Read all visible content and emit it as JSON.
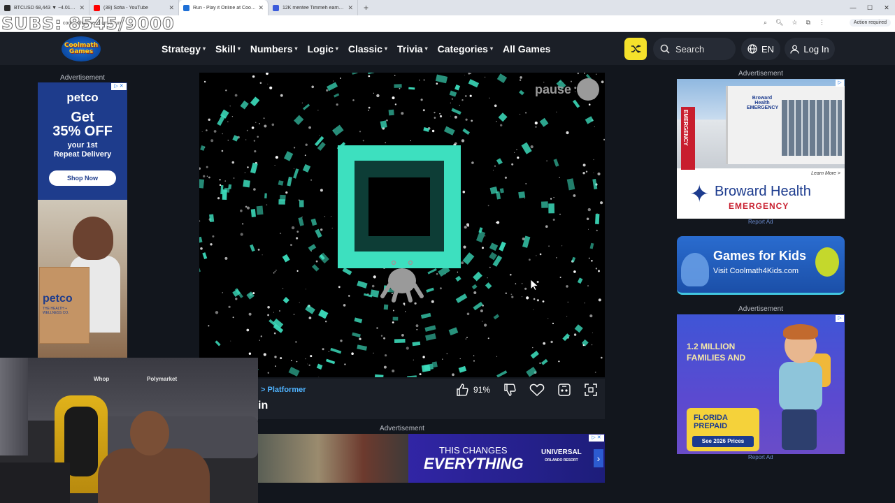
{
  "browser": {
    "tabs": [
      {
        "label": "BTCUSD 68,443 ▼ −4.01% Mi...",
        "favicon_color": "#2b2b2b",
        "active": false
      },
      {
        "label": "(38) Sofia - YouTube",
        "favicon_color": "#ff0000",
        "active": false
      },
      {
        "label": "Run - Play it Online at Coolmath...",
        "favicon_color": "#1f70d6",
        "active": true
      },
      {
        "label": "12K mentee Timmeh earns prop...",
        "favicon_color": "#3b5bdb",
        "active": false
      }
    ],
    "url": "coolmathgames.com/0-run",
    "action_required": "Action required",
    "overlay_text": "SUBS: 8545/9000"
  },
  "site": {
    "logo_line1": "Coolmath",
    "logo_line2": "Games",
    "menu": [
      {
        "label": "Strategy",
        "dropdown": true
      },
      {
        "label": "Skill",
        "dropdown": true
      },
      {
        "label": "Numbers",
        "dropdown": true
      },
      {
        "label": "Logic",
        "dropdown": true
      },
      {
        "label": "Classic",
        "dropdown": true
      },
      {
        "label": "Trivia",
        "dropdown": true
      },
      {
        "label": "Categories",
        "dropdown": true
      },
      {
        "label": "All Games",
        "dropdown": false
      }
    ],
    "search_label": "Search",
    "lang_label": "EN",
    "login_label": "Log In",
    "accent_color": "#f5e12b"
  },
  "ad_label": "Advertisement",
  "report_ad": "Report Ad",
  "left_ad": {
    "brand": "petco",
    "offer_line1": "Get",
    "offer_line2": "35% OFF",
    "sub_line1": "your 1st",
    "sub_line2": "Repeat Delivery",
    "cta": "Shop Now",
    "box_brand": "petco",
    "box_tag": "THE HEALTH + WELLNESS CO."
  },
  "game": {
    "pause_label": "pause",
    "breadcrumb": "> Platformer",
    "title_fragment": "in",
    "rating": "91%",
    "tunnel_color": "#3de0bf"
  },
  "bottom_ad": {
    "tagline_small": "THIS CHANGES",
    "tagline_big": "EVERYTHING",
    "logo_line1": "UNIVERSAL",
    "logo_line2": "ORLANDO RESORT"
  },
  "right_ad_1": {
    "building_sign": "Broward Health EMERGENCY",
    "learn_more": "Learn More >",
    "name": "Broward Health",
    "emergency": "EMERGENCY",
    "side_sign": "EMERGENCY"
  },
  "right_ad_2": {
    "title": "Games for Kids",
    "subtitle": "Visit Coolmath4Kids.com"
  },
  "right_ad_3": {
    "headline_line1": "1.2 MILLION",
    "headline_line2": "FAMILIES AND",
    "brand_line1": "FLORIDA",
    "brand_line2": "PREPAID",
    "cta": "See 2026 Prices"
  },
  "webcam": {
    "sponsor1": "Whop",
    "sponsor2": "Polymarket"
  }
}
